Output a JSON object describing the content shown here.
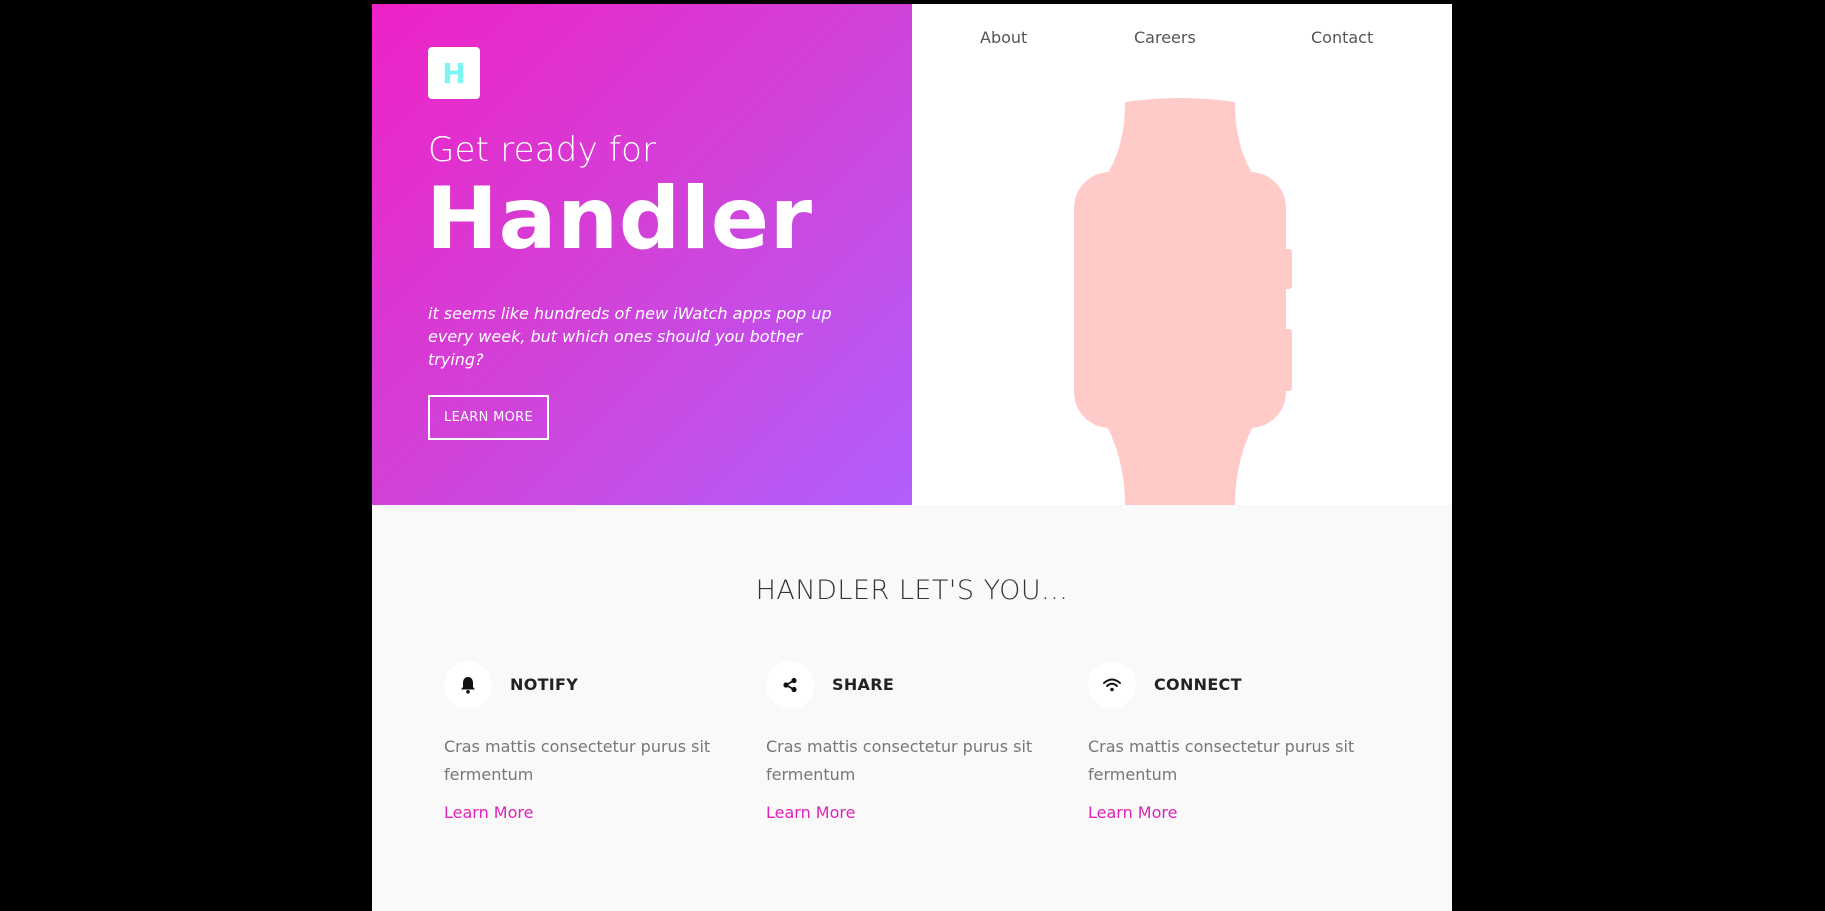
{
  "hero": {
    "logo_letter": "H",
    "kicker": "Get ready for",
    "brand": "Handler",
    "tagline": "it seems like hundreds of new iWatch apps pop up every week, but which ones should you bother trying?",
    "cta_label": "LEARN MORE",
    "gradient": [
      "#ee22c6",
      "#b15ffc"
    ],
    "watch_color": "#ffcbc8"
  },
  "nav": {
    "items": [
      {
        "label": "About"
      },
      {
        "label": "Careers"
      },
      {
        "label": "Contact"
      }
    ]
  },
  "features": {
    "title": "HANDLER LET'S YOU...",
    "items": [
      {
        "icon": "bell-icon",
        "heading": "NOTIFY",
        "text": "Cras mattis consectetur purus sit fermentum",
        "link": "Learn More"
      },
      {
        "icon": "share-icon",
        "heading": "SHARE",
        "text": "Cras mattis consectetur purus sit fermentum",
        "link": "Learn More"
      },
      {
        "icon": "wifi-icon",
        "heading": "CONNECT",
        "text": "Cras mattis consectetur purus sit fermentum",
        "link": "Learn More"
      }
    ],
    "link_color": "#e023b8"
  }
}
